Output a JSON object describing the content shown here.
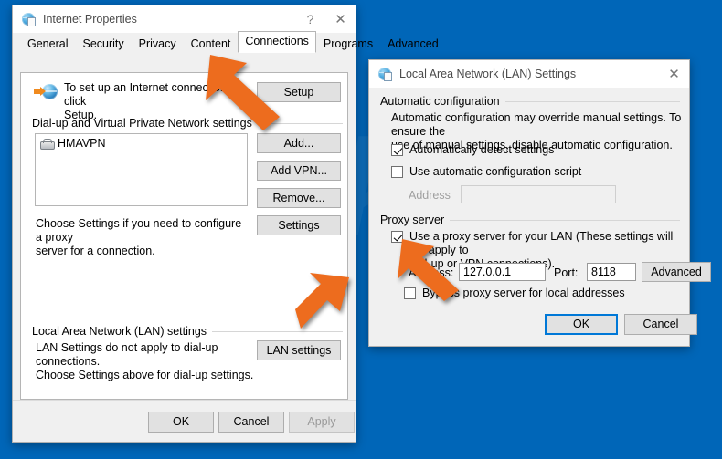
{
  "background": {
    "color": "#0066b8",
    "watermark_text": "pcrisk"
  },
  "internet_properties": {
    "title": "Internet Properties",
    "titlebar_icon": "internet-properties-icon",
    "help_button": "?",
    "close_button": "✕",
    "tabs": [
      {
        "label": "General",
        "active": false
      },
      {
        "label": "Security",
        "active": false
      },
      {
        "label": "Privacy",
        "active": false
      },
      {
        "label": "Content",
        "active": false
      },
      {
        "label": "Connections",
        "active": true
      },
      {
        "label": "Programs",
        "active": false
      },
      {
        "label": "Advanced",
        "active": false
      }
    ],
    "setup_section": {
      "icon": "globe-arrow-icon",
      "text_line1": "To set up an Internet connection, click",
      "text_line2": "Setup.",
      "setup_button": "Setup"
    },
    "dialup_section": {
      "group_label": "Dial-up and Virtual Private Network settings",
      "list_items": [
        {
          "icon": "modem-icon",
          "label": "HMAVPN"
        }
      ],
      "buttons": [
        "Add...",
        "Add VPN...",
        "Remove...",
        "Settings"
      ],
      "hint_line1": "Choose Settings if you need to configure a proxy",
      "hint_line2": "server for a connection."
    },
    "lan_section": {
      "group_label": "Local Area Network (LAN) settings",
      "hint_line1": "LAN Settings do not apply to dial-up connections.",
      "hint_line2": "Choose Settings above for dial-up settings.",
      "lan_settings_button": "LAN settings"
    },
    "footer_buttons": [
      {
        "label": "OK",
        "disabled": false
      },
      {
        "label": "Cancel",
        "disabled": false
      },
      {
        "label": "Apply",
        "disabled": true
      }
    ]
  },
  "lan_settings": {
    "title": "Local Area Network (LAN) Settings",
    "titlebar_icon": "lan-settings-icon",
    "close_button": "✕",
    "automatic_configuration": {
      "group_label": "Automatic configuration",
      "description_line1": "Automatic configuration may override manual settings.  To ensure the",
      "description_line2": "use of manual settings, disable automatic configuration.",
      "auto_detect": {
        "label": "Automatically detect settings",
        "checked": true
      },
      "use_script": {
        "label": "Use automatic configuration script",
        "checked": false
      },
      "address_label": "Address",
      "address_value": "",
      "address_enabled": false
    },
    "proxy_server": {
      "group_label": "Proxy server",
      "use_proxy": {
        "label_line1": "Use a proxy server for your LAN (These settings will not apply to",
        "label_line2": "dial-up or VPN connections).",
        "checked": true
      },
      "address_label": "Address:",
      "address_value": "127.0.0.1",
      "port_label": "Port:",
      "port_value": "8118",
      "advanced_button": "Advanced",
      "bypass": {
        "label": "Bypass proxy server for local addresses",
        "checked": false
      }
    },
    "footer_buttons": [
      {
        "label": "OK",
        "default": true
      },
      {
        "label": "Cancel",
        "default": false
      }
    ]
  },
  "annotations": {
    "arrow_color": "#ed6c1e",
    "arrows": [
      {
        "name": "arrow-to-connections-tab",
        "direction": "up-left"
      },
      {
        "name": "arrow-to-lan-settings-button",
        "direction": "down-left"
      },
      {
        "name": "arrow-to-use-proxy-checkbox",
        "direction": "up-left"
      }
    ]
  }
}
